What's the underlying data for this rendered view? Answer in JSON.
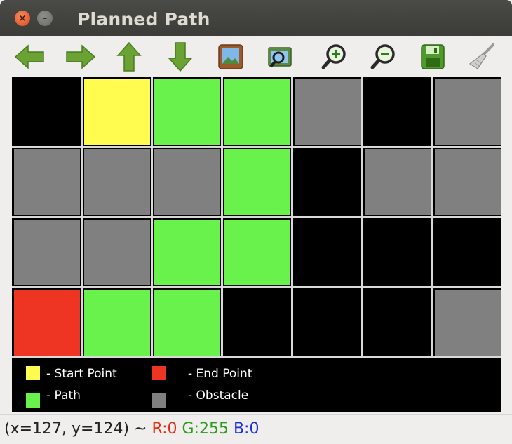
{
  "window": {
    "title": "Planned Path",
    "close_glyph": "×",
    "minimize_glyph": "–"
  },
  "toolbar": {
    "buttons": [
      {
        "icon": "arrow-left-icon"
      },
      {
        "icon": "arrow-right-icon"
      },
      {
        "icon": "arrow-up-icon"
      },
      {
        "icon": "arrow-down-icon"
      },
      {
        "icon": "image-icon"
      },
      {
        "icon": "zoom-image-icon"
      },
      {
        "icon": "zoom-in-icon"
      },
      {
        "icon": "zoom-out-icon"
      },
      {
        "icon": "save-icon"
      },
      {
        "icon": "brush-icon"
      }
    ]
  },
  "grid": {
    "rows": 4,
    "cols": 7,
    "cells": [
      [
        "free",
        "start",
        "path",
        "path",
        "obstacle",
        "free",
        "obstacle"
      ],
      [
        "obstacle",
        "obstacle",
        "obstacle",
        "path",
        "free",
        "obstacle",
        "obstacle"
      ],
      [
        "obstacle",
        "obstacle",
        "path",
        "path",
        "free",
        "free",
        "free"
      ],
      [
        "end",
        "path",
        "path",
        "free",
        "free",
        "free",
        "obstacle"
      ]
    ],
    "colors": {
      "start": "#fffb4f",
      "path": "#6af24c",
      "end": "#ee3423",
      "obstacle": "#808080",
      "free": "#000000"
    }
  },
  "legend": {
    "start_label": "- Start Point",
    "end_label": "- End Point",
    "path_label": "- Path",
    "obstacle_label": "- Obstacle"
  },
  "status": {
    "coords": "(x=127, y=124) ~ ",
    "r": "R:0",
    "g": "G:255",
    "b": "B:0"
  }
}
